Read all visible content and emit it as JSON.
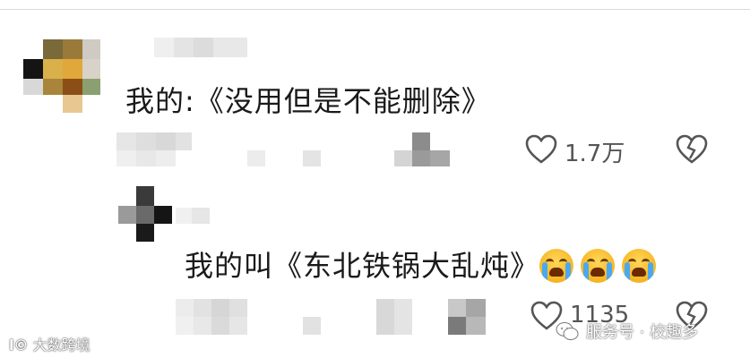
{
  "comments": [
    {
      "text": "我的:《没用但是不能删除》",
      "likes": "1.7万"
    },
    {
      "text": "我的叫《东北铁锅大乱炖》",
      "emoji": "crying-face-icon",
      "likes": "1135"
    }
  ],
  "watermark": {
    "left": "大数跨境",
    "right": "服务号 · 校趣多"
  },
  "colors": {
    "text": "#1a1a1a",
    "icon": "#555555",
    "emoji_yellow": "#f5b623",
    "tear_blue": "#4aa8f0"
  }
}
